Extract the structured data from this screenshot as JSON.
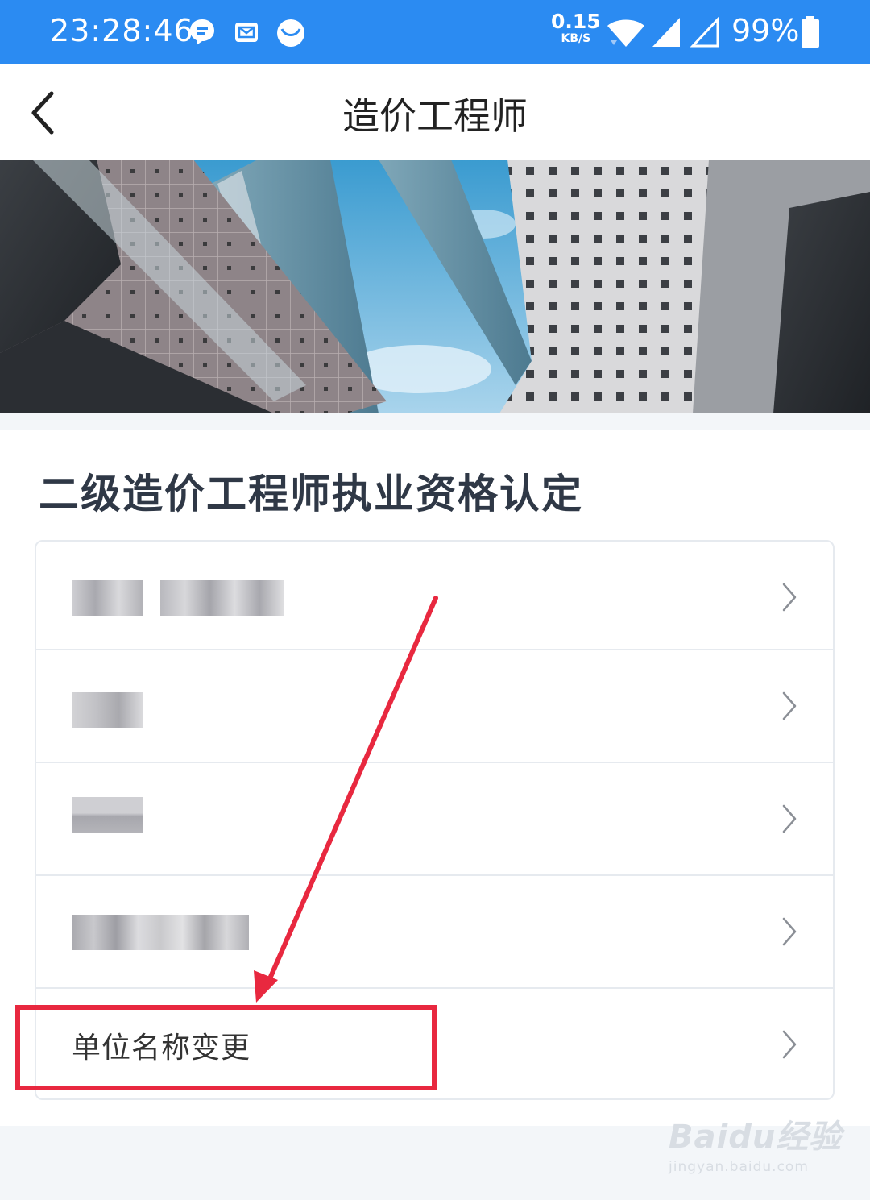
{
  "status_bar": {
    "time": "23:28:46",
    "net_speed_value": "0.15",
    "net_speed_unit": "KB/S",
    "battery": "99%",
    "icons": [
      "chat-notification-icon",
      "mail-icon",
      "moon-app-icon",
      "wifi-icon",
      "signal-icon",
      "signal-empty-icon",
      "battery-icon"
    ]
  },
  "header": {
    "title": "造价工程师",
    "back_icon": "chevron-left-icon"
  },
  "banner": {
    "image": "architecture-skyscrapers-photo"
  },
  "section": {
    "title": "二级造价工程师执业资格认定"
  },
  "list": {
    "items": [
      {
        "label": "",
        "blurred": true
      },
      {
        "label": "",
        "blurred": true
      },
      {
        "label": "",
        "blurred": true
      },
      {
        "label": "",
        "blurred": true
      },
      {
        "label": "单位名称变更",
        "blurred": false
      }
    ],
    "chevron_icon": "chevron-right-icon"
  },
  "annotation": {
    "color": "#e8283f"
  },
  "watermark": {
    "main": "Baidu经验",
    "sub": "jingyan.baidu.com"
  },
  "colors": {
    "status_bar": "#2b8bf2",
    "title_text": "#2f3846",
    "background": "#f3f6f9"
  }
}
